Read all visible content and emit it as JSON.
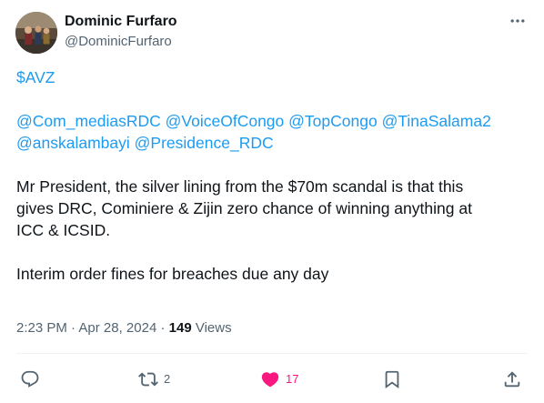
{
  "author": {
    "display_name": "Dominic Furfaro",
    "handle": "@DominicFurfaro"
  },
  "tweet": {
    "cashtag": "$AVZ",
    "mentions_line1": [
      "@Com_mediasRDC",
      "@VoiceOfCongo",
      "@TopCongo",
      "@TinaSalama2"
    ],
    "mentions_line2": [
      "@anskalambayi",
      "@Presidence_RDC"
    ],
    "paragraph1_lines": [
      "Mr President, the silver lining from the $70m scandal is that this",
      "gives DRC, Cominiere & Zijin zero chance of winning anything at",
      "ICC & ICSID."
    ],
    "paragraph2": "Interim order fines for breaches due any day"
  },
  "meta": {
    "time": "2:23 PM",
    "separator": "·",
    "date": "Apr 28, 2024",
    "views_count": "149",
    "views_label": "Views"
  },
  "actions": {
    "reply": {
      "icon": "reply-icon",
      "count": ""
    },
    "retweet": {
      "icon": "retweet-icon",
      "count": "2"
    },
    "like": {
      "icon": "heart-icon",
      "count": "17",
      "color": "#f91880"
    },
    "bookmark": {
      "icon": "bookmark-icon"
    },
    "share": {
      "icon": "share-icon"
    }
  },
  "colors": {
    "link": "#1d9bf0",
    "text": "#0f1419",
    "secondary": "#536471",
    "like": "#f91880"
  }
}
